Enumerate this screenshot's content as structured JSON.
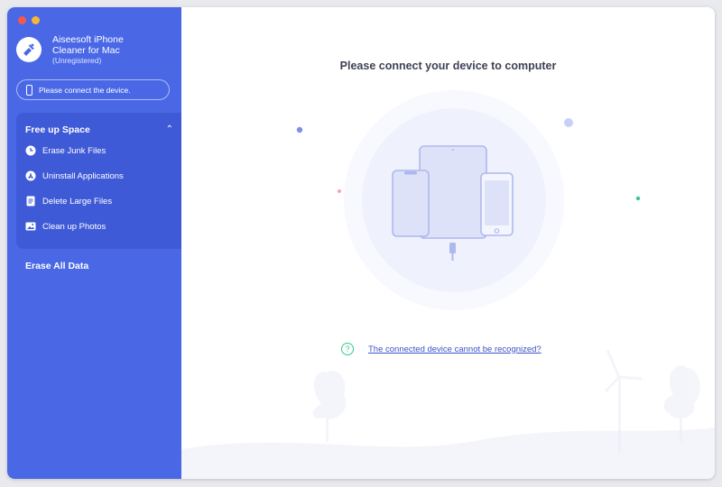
{
  "app": {
    "title_line1": "Aiseesoft iPhone",
    "title_line2": "Cleaner for Mac",
    "status": "(Unregistered)"
  },
  "device_pill": {
    "label": "Please connect the device."
  },
  "sidebar": {
    "group_title": "Free up Space",
    "items": [
      {
        "label": "Erase Junk Files",
        "icon": "clock-icon"
      },
      {
        "label": "Uninstall Applications",
        "icon": "app-store-icon"
      },
      {
        "label": "Delete Large Files",
        "icon": "document-icon"
      },
      {
        "label": "Clean up Photos",
        "icon": "photo-icon"
      }
    ],
    "erase_all": "Erase All Data"
  },
  "main": {
    "headline": "Please connect your device to computer",
    "help_link": "The connected device cannot be recognized?"
  },
  "colors": {
    "sidebar_bg": "#4a68e6",
    "group_bg": "#3f5ad6",
    "accent_green": "#35c98b",
    "link": "#3c52c8"
  }
}
